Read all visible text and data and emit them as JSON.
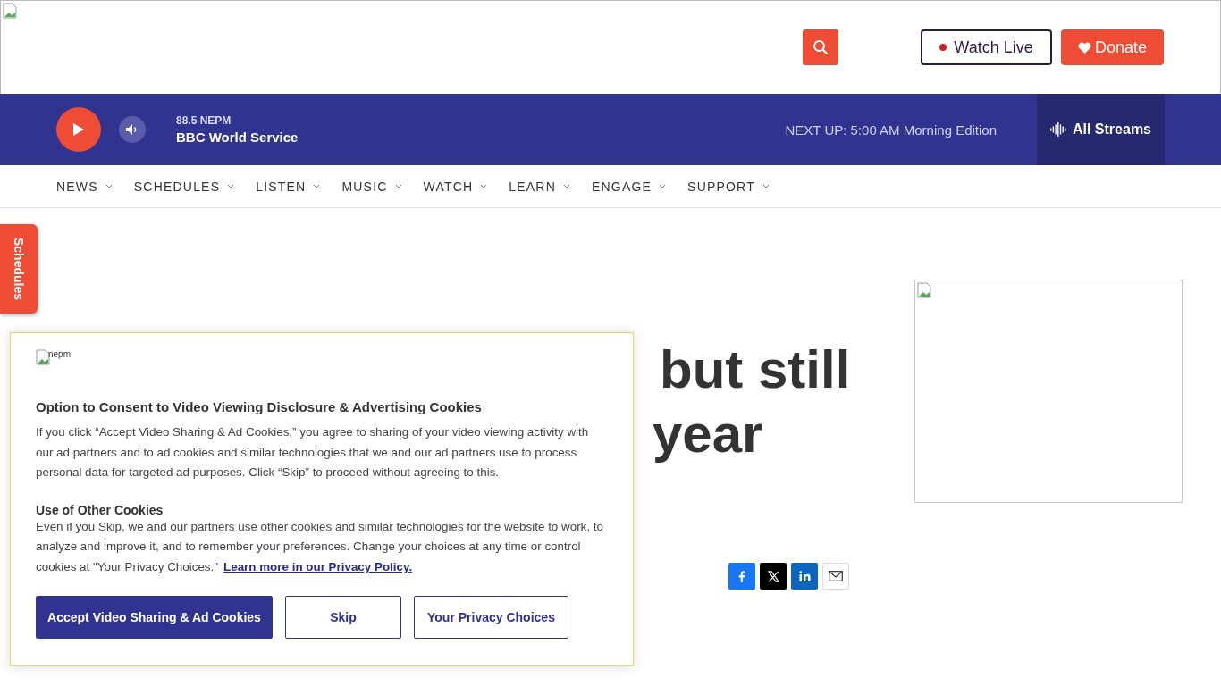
{
  "header": {
    "watch_live": "Watch Live",
    "donate": "Donate"
  },
  "player": {
    "station": "88.5 NEPM",
    "program": "BBC World Service",
    "next_up": "NEXT UP: 5:00 AM Morning Edition",
    "all_streams": "All Streams"
  },
  "nav": [
    "NEWS",
    "SCHEDULES",
    "LISTEN",
    "MUSIC",
    "WATCH",
    "LEARN",
    "ENGAGE",
    "SUPPORT"
  ],
  "side_tab": "Schedules",
  "headline_lines": [
    "but still",
    "year"
  ],
  "share": [
    {
      "kind": "facebook"
    },
    {
      "kind": "x"
    },
    {
      "kind": "linkedin"
    },
    {
      "kind": "email"
    }
  ],
  "consent": {
    "logo_alt": "nepm",
    "title": "Option to Consent to Video Viewing Disclosure & Advertising Cookies",
    "body": "If you click “Accept Video Sharing & Ad Cookies,” you agree to sharing of your video viewing activity with our ad partners and to ad cookies and similar technologies that we and our ad partners use to process personal data for targeted ad purposes. Click “Skip” to proceed without agreeing to this.",
    "subtitle": "Use of Other Cookies",
    "body2": "Even if you Skip, we and our partners use other cookies and similar technologies for the website to work, to analyze and improve it, and to remember your preferences. Change your choices at any time or control cookies at \"Your Privacy Choices.\"",
    "link": "Learn more in our Privacy Policy.",
    "buttons": [
      {
        "label": "Accept Video Sharing & Ad Cookies",
        "kind": "primary"
      },
      {
        "label": "Skip",
        "kind": "outline"
      },
      {
        "label": "Your Privacy Choices",
        "kind": "outline"
      }
    ]
  }
}
